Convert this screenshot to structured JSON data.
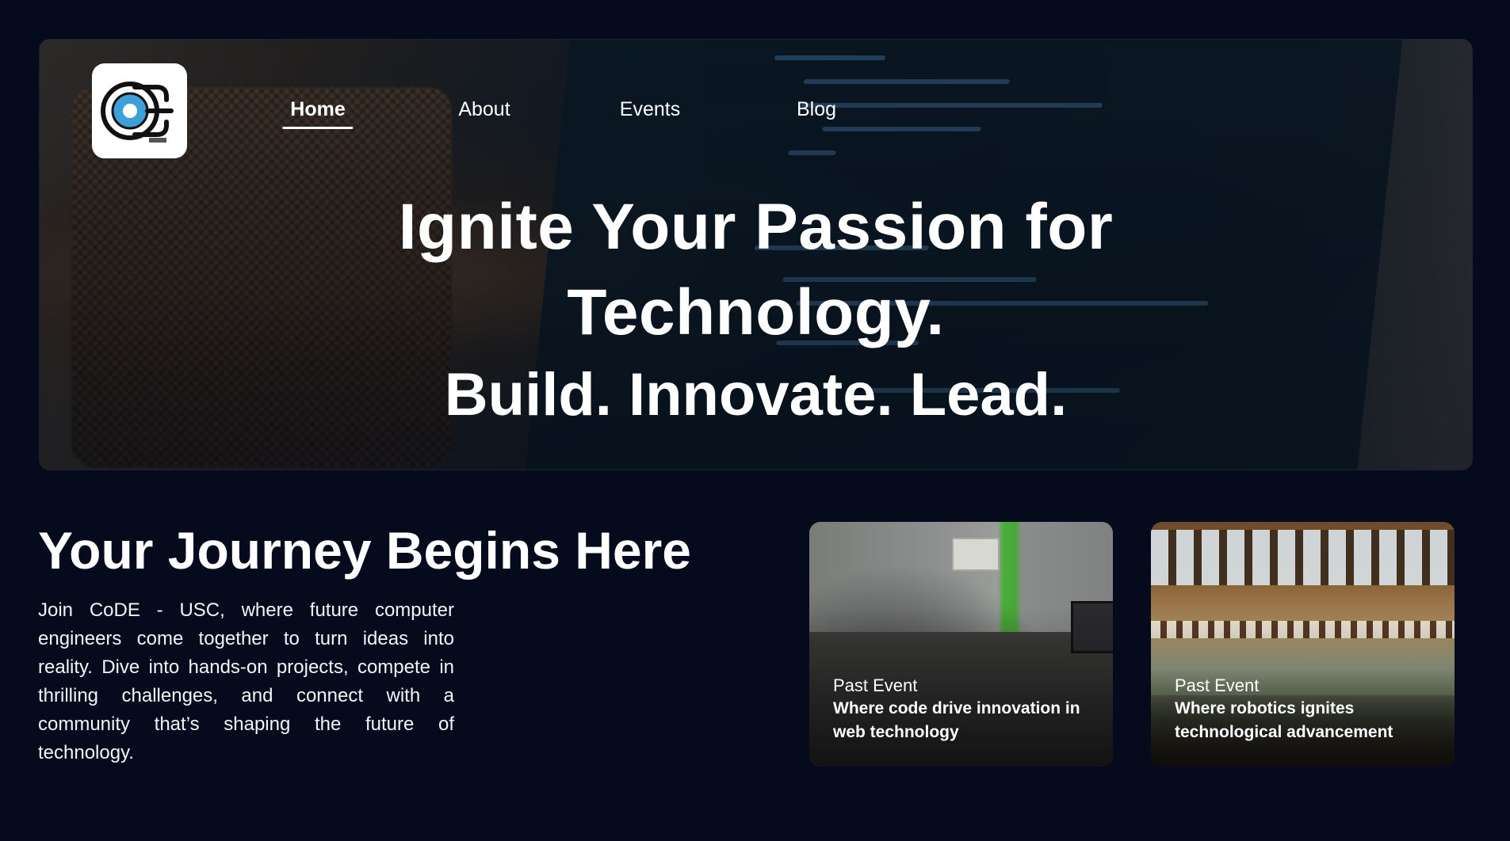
{
  "nav": {
    "items": [
      {
        "label": "Home",
        "active": true
      },
      {
        "label": "About",
        "active": false
      },
      {
        "label": "Events",
        "active": false
      },
      {
        "label": "Blog",
        "active": false
      }
    ]
  },
  "logo": {
    "icon": "code-usc-logo",
    "text": "CODE"
  },
  "hero": {
    "title_line1": "Ignite Your Passion for",
    "title_line2": "Technology.",
    "subtitle": "Build. Innovate. Lead."
  },
  "journey": {
    "title": "Your Journey Begins Here",
    "body": "Join CoDE - USC, where future computer engineers come together to turn ideas into reality. Dive into hands-on projects, compete in thrilling challenges, and connect with a community that’s shaping the future of technology."
  },
  "events": [
    {
      "label": "Past Event",
      "title": "Where code drive innovation in web technology"
    },
    {
      "label": "Past Event",
      "title": "Where robotics ignites technological advancement"
    }
  ],
  "colors": {
    "background": "#050b1c",
    "text": "#ffffff"
  }
}
